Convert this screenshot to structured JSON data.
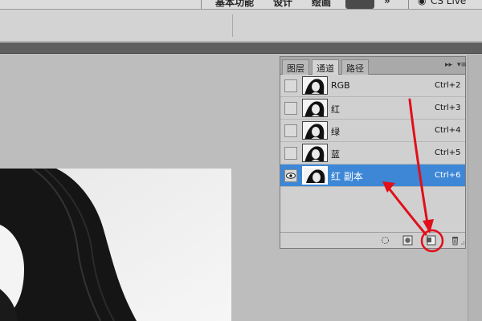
{
  "workspace_switcher": {
    "items": [
      "基本功能",
      "设计",
      "绘画"
    ],
    "live_label": "CS Live"
  },
  "channels_panel": {
    "tabs": [
      "图层",
      "通道",
      "路径"
    ],
    "active_tab": "通道",
    "channels": [
      {
        "name": "RGB",
        "shortcut": "Ctrl+2",
        "visible": false,
        "selected": false
      },
      {
        "name": "红",
        "shortcut": "Ctrl+3",
        "visible": false,
        "selected": false
      },
      {
        "name": "绿",
        "shortcut": "Ctrl+4",
        "visible": false,
        "selected": false
      },
      {
        "name": "蓝",
        "shortcut": "Ctrl+5",
        "visible": false,
        "selected": false
      },
      {
        "name": "红 副本",
        "shortcut": "Ctrl+6",
        "visible": true,
        "selected": true
      }
    ],
    "footer_buttons": [
      "load-selection-icon",
      "save-selection-icon",
      "new-channel-icon",
      "trash-icon"
    ],
    "highlighted_button": "new-channel-icon"
  },
  "colors": {
    "selection": "#3d87d6",
    "annotation": "#e0101a",
    "panel_bg": "#d0d0d0",
    "workspace_bg": "#bdbdbd"
  }
}
